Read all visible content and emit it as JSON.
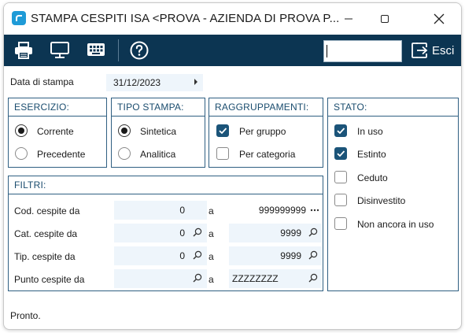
{
  "window": {
    "title": "STAMPA CESPITI ISA <PROVA - AZIENDA DI PROVA P...",
    "icons": [
      "app-icon",
      "minimize-icon",
      "maximize-icon",
      "close-icon"
    ]
  },
  "toolbar": {
    "background": "#0c3552",
    "buttons": [
      "printer-icon",
      "monitor-icon",
      "keyboard-icon",
      "help-icon"
    ],
    "search_value": "",
    "exit_label": "Esci"
  },
  "date": {
    "label": "Data di stampa",
    "value": "31/12/2023"
  },
  "esercizio": {
    "title": "ESERCIZIO:",
    "options": [
      {
        "label": "Corrente",
        "selected": true
      },
      {
        "label": "Precedente",
        "selected": false
      }
    ]
  },
  "tipo_stampa": {
    "title": "TIPO STAMPA:",
    "options": [
      {
        "label": "Sintetica",
        "selected": true
      },
      {
        "label": "Analitica",
        "selected": false
      }
    ]
  },
  "raggruppamenti": {
    "title": "RAGGRUPPAMENTI:",
    "options": [
      {
        "label": "Per gruppo",
        "checked": true
      },
      {
        "label": "Per categoria",
        "checked": false
      }
    ]
  },
  "stato": {
    "title": "STATO:",
    "options": [
      {
        "label": "In uso",
        "checked": true
      },
      {
        "label": "Estinto",
        "checked": true
      },
      {
        "label": "Ceduto",
        "checked": false
      },
      {
        "label": "Disinvestito",
        "checked": false
      },
      {
        "label": "Non ancora in uso",
        "checked": false
      }
    ]
  },
  "filtri": {
    "title": "FILTRI:",
    "to_label": "a",
    "rows": [
      {
        "label": "Cod. cespite da",
        "from": "0",
        "to": "999999999",
        "to_icon": "ellipsis-icon"
      },
      {
        "label": "Cat. cespite da",
        "from": "0",
        "to": "9999",
        "to_icon": "search-icon"
      },
      {
        "label": "Tip. cespite da",
        "from": "0",
        "to": "9999",
        "to_icon": "search-icon"
      },
      {
        "label": "Punto cespite da",
        "from": "",
        "to": "ZZZZZZZZ",
        "to_icon": "search-icon"
      }
    ]
  },
  "status": {
    "text": "Pronto."
  }
}
